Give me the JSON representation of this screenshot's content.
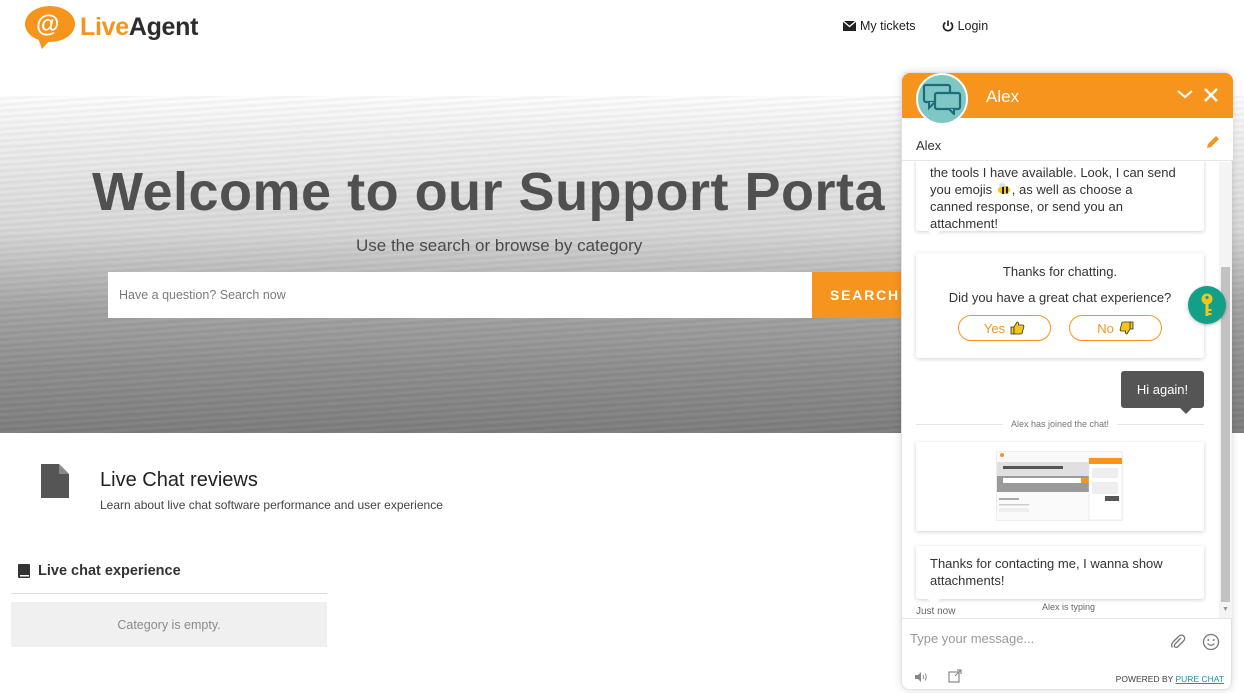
{
  "header": {
    "logo_live": "Live",
    "logo_agent": "Agent",
    "nav": {
      "my_tickets": "My tickets",
      "login": "Login"
    }
  },
  "hero": {
    "title": "Welcome to our Support Porta",
    "subtitle": "Use the search or browse by category",
    "search_placeholder": "Have a question? Search now",
    "search_button": "SEARCH"
  },
  "category": {
    "title": "Live Chat reviews",
    "description": "Learn about live chat software performance and user experience",
    "subcategory": "Live chat experience",
    "empty_text": "Category is empty."
  },
  "chat": {
    "agent_name": "Alex",
    "visitor_name": "Alex",
    "messages": {
      "m1_line1": "the tools I have available. Look, I can send",
      "m1_line2a": "you emojis ",
      "m1_line2b": ", as well as choose a",
      "m1_line3": "canned response, or send you an",
      "m1_line4": "attachment!",
      "feedback_thanks": "Thanks for chatting.",
      "feedback_question": "Did you have a great chat experience?",
      "feedback_yes": "Yes",
      "feedback_no": "No",
      "user_msg": "Hi again!",
      "system_joined": "Alex has joined the chat!",
      "m4_line1": "Thanks for contacting me, I wanna show",
      "m4_line2": "attachments!"
    },
    "timestamp": "Just now",
    "typing": "Alex is typing",
    "input_placeholder": "Type your message...",
    "powered_by": "POWERED BY ",
    "powered_link": "PURE CHAT"
  },
  "colors": {
    "accent": "#f7941d",
    "teal": "#13a089",
    "dark_bubble": "#555555"
  },
  "icons": [
    "envelope-icon",
    "power-icon",
    "document-icon",
    "book-icon",
    "chat-bubbles-icon",
    "chevron-down-icon",
    "close-icon",
    "pencil-icon",
    "thumbs-up-icon",
    "thumbs-down-icon",
    "paperclip-icon",
    "smiley-icon",
    "sound-icon",
    "popout-icon",
    "key-icon"
  ]
}
